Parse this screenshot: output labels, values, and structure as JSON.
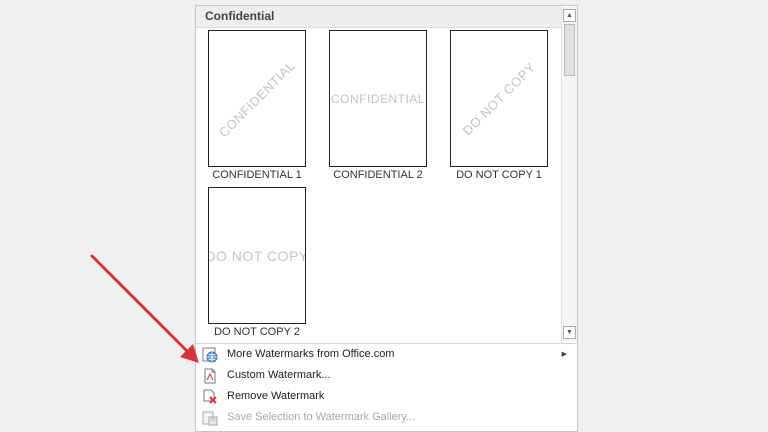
{
  "gallery": {
    "section_title": "Confidential",
    "items": [
      {
        "label": "CONFIDENTIAL 1",
        "watermark": "CONFIDENTIAL",
        "layout": "diagonal"
      },
      {
        "label": "CONFIDENTIAL 2",
        "watermark": "CONFIDENTIAL",
        "layout": "horizontal"
      },
      {
        "label": "DO NOT COPY 1",
        "watermark": "DO NOT COPY",
        "layout": "diagonal"
      },
      {
        "label": "DO NOT COPY 2",
        "watermark": "DO NOT COPY",
        "layout": "horizontal"
      }
    ]
  },
  "menu": {
    "more_watermarks": "More Watermarks from Office.com",
    "custom_watermark": "Custom Watermark...",
    "remove_watermark": "Remove Watermark",
    "save_selection": "Save Selection to Watermark Gallery..."
  },
  "colors": {
    "annotation_arrow": "#d3353a",
    "watermark_text": "#c4c4c4"
  },
  "icons": {
    "more_watermarks": "globe-icon",
    "custom_watermark": "document-icon",
    "remove_watermark": "remove-watermark-icon",
    "save_selection": "save-gallery-icon",
    "submenu": "chevron-right-icon",
    "scroll_up": "scroll-up-icon",
    "scroll_down": "scroll-down-icon"
  }
}
